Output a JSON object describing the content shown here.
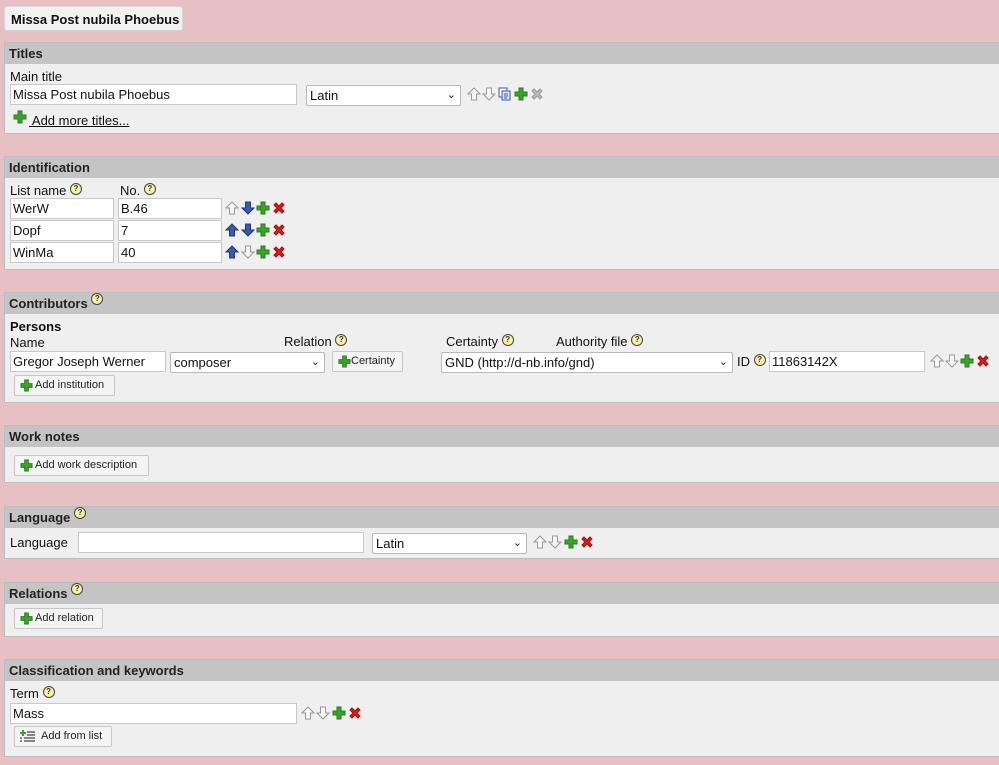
{
  "tab": {
    "title": "Missa Post nubila Phoebus"
  },
  "titles": {
    "heading": "Titles",
    "main_title_label": "Main title",
    "main_title_value": "Missa Post nubila Phoebus",
    "language_selected": "Latin",
    "add_more_label": " Add more titles..."
  },
  "identification": {
    "heading": "Identification",
    "list_name_label": "List name",
    "no_label": "No.",
    "rows": [
      {
        "list_name": "WerW",
        "no": "B.46"
      },
      {
        "list_name": "Dopf",
        "no": "7"
      },
      {
        "list_name": "WinMa",
        "no": "40"
      }
    ]
  },
  "contributors": {
    "heading": "Contributors",
    "persons_label": "Persons",
    "name_label": "Name",
    "relation_label": "Relation",
    "certainty_label": "Certainty",
    "authority_label": "Authority file",
    "person_name": "Gregor Joseph Werner",
    "relation_selected": "composer",
    "certainty_button": "Certainty",
    "authority_selected": "GND (http://d-nb.info/gnd)",
    "id_label": "ID",
    "id_value": "11863142X",
    "add_institution": "Add institution"
  },
  "work_notes": {
    "heading": "Work notes",
    "add_description": "Add work description"
  },
  "language": {
    "heading": "Language",
    "language_label": "Language",
    "language_text": "",
    "language_selected": "Latin"
  },
  "relations": {
    "heading": "Relations",
    "add_relation": "Add relation"
  },
  "classification": {
    "heading": "Classification and keywords",
    "term_label": "Term",
    "term_value": "Mass",
    "add_from_list": "Add from list"
  },
  "help_glyph": "?",
  "colors": {
    "background": "#e6c0c3",
    "panel": "#efefef",
    "panel_header": "#c4c4c4",
    "plus_green": "#3aa32a",
    "delete_red": "#d42020",
    "arrow_blue": "#3b5aa8"
  }
}
